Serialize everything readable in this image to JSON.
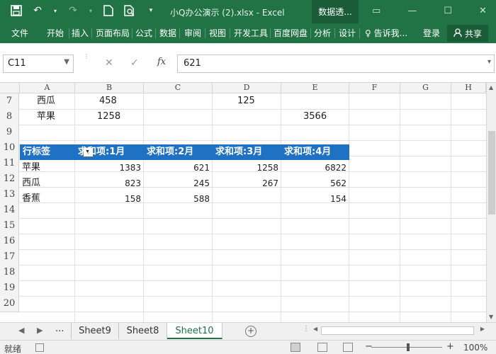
{
  "window": {
    "title": "小Q办公演示 (2).xlsx - Excel",
    "tools_tab": "数据透...",
    "share": "共享",
    "signin": "登录"
  },
  "ribbon": {
    "tabs": [
      "文件",
      "开始",
      "插入",
      "页面布局",
      "公式",
      "数据",
      "审阅",
      "视图",
      "开发工具",
      "百度网盘",
      "分析",
      "设计"
    ],
    "tell_me": "告诉我..."
  },
  "formula_bar": {
    "name_box": "C11",
    "formula": "621",
    "fx": "fx"
  },
  "grid": {
    "columns": [
      "A",
      "B",
      "C",
      "D",
      "E",
      "F",
      "G",
      "H"
    ],
    "rows": [
      "7",
      "8",
      "9",
      "10",
      "11",
      "12",
      "13",
      "14",
      "15",
      "16",
      "17",
      "18",
      "19",
      "20"
    ],
    "row7": {
      "a": "西瓜",
      "b": "458",
      "d": "125"
    },
    "row8": {
      "a": "苹果",
      "b": "1258",
      "e": "3566"
    },
    "pivot": {
      "headers": [
        "行标签",
        "求和项:1月",
        "求和项:2月",
        "求和项:3月",
        "求和项:4月"
      ],
      "rows": [
        {
          "label": "苹果",
          "v": [
            "1383",
            "621",
            "1258",
            "6822"
          ]
        },
        {
          "label": "西瓜",
          "v": [
            "823",
            "245",
            "267",
            "562"
          ]
        },
        {
          "label": "香蕉",
          "v": [
            "158",
            "588",
            "",
            "154"
          ]
        }
      ]
    }
  },
  "sheets": {
    "ellipsis": "...",
    "tabs": [
      "Sheet9",
      "Sheet8",
      "Sheet10"
    ],
    "active": "Sheet10"
  },
  "status": {
    "ready": "就绪",
    "zoom": "100%"
  },
  "colors": {
    "excel_green": "#217346",
    "pivot_header": "#1f71c4"
  }
}
